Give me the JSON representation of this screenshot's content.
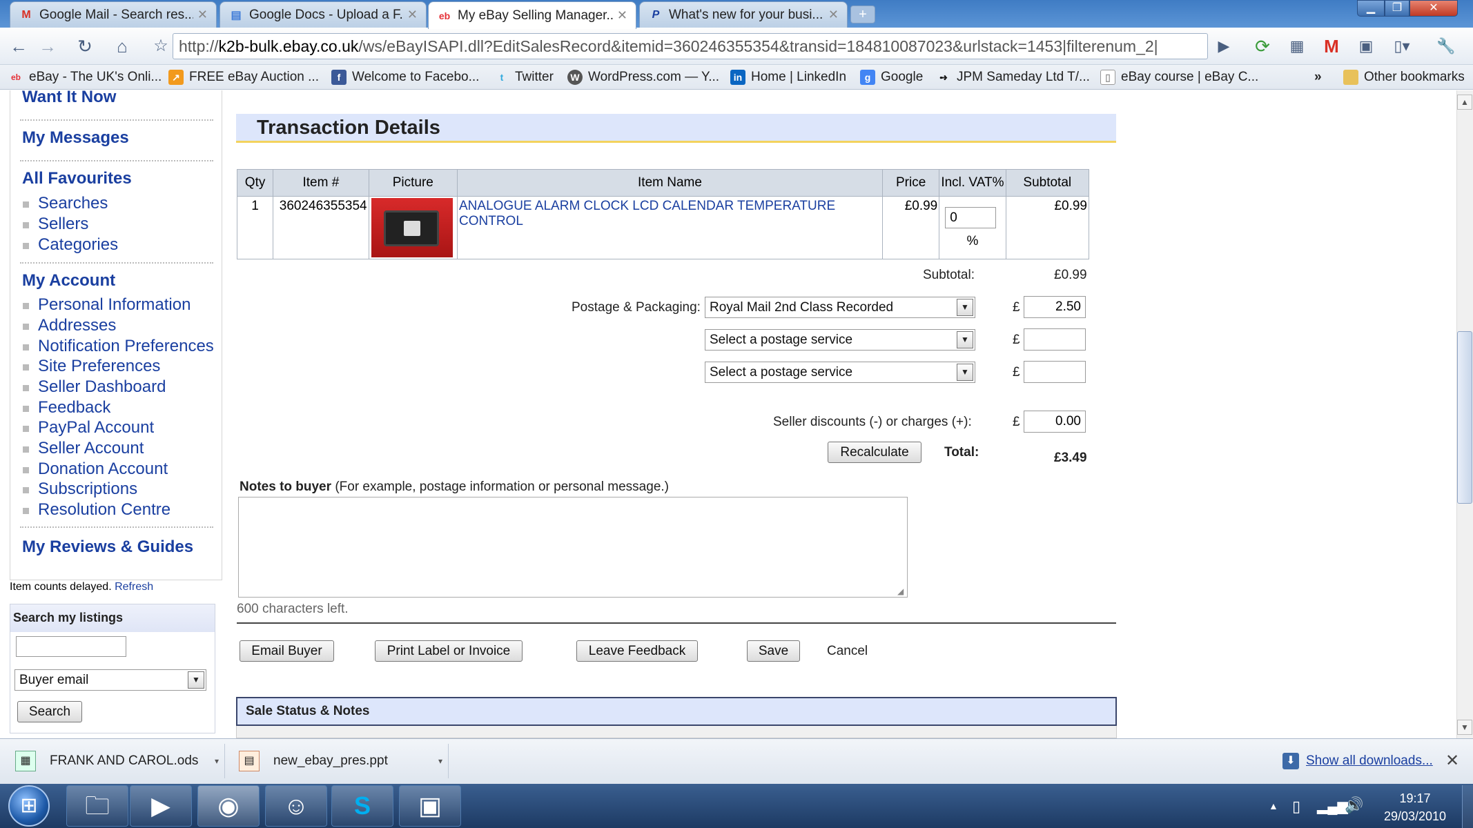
{
  "browser": {
    "tabs": [
      {
        "title": "Google Mail - Search res...",
        "icon": "gmail-icon"
      },
      {
        "title": "Google Docs - Upload a F...",
        "icon": "docs-icon"
      },
      {
        "title": "My eBay Selling Manager...",
        "icon": "ebay-icon"
      },
      {
        "title": "What's new for your busi...",
        "icon": "paypal-icon"
      }
    ],
    "url_prefix": "http://",
    "url_host": "k2b-bulk.ebay.co.uk",
    "url_path": "/ws/eBayISAPI.dll?EditSalesRecord&itemid=360246355354&transid=184810087023&urlstack=1453|filterenum_2|",
    "bookmarks": [
      "eBay - The UK's Onli...",
      "FREE eBay Auction ...",
      "Welcome to Facebo...",
      "Twitter",
      "WordPress.com — Y...",
      "Home | LinkedIn",
      "Google",
      "JPM Sameday Ltd T/...",
      "eBay course | eBay C..."
    ],
    "other_bookmarks": "Other bookmarks",
    "more": "»"
  },
  "sidebar": {
    "top_partial": "Want It Now",
    "messages": "My Messages",
    "favourites": "All Favourites",
    "fav_items": [
      "Searches",
      "Sellers",
      "Categories"
    ],
    "account": "My Account",
    "account_items": [
      "Personal Information",
      "Addresses",
      "Notification Preferences",
      "Site Preferences",
      "Seller Dashboard",
      "Feedback",
      "PayPal Account",
      "Seller Account",
      "Donation Account",
      "Subscriptions",
      "Resolution Centre"
    ],
    "reviews": "My Reviews & Guides",
    "delay_note": "Item counts delayed.",
    "refresh": "Refresh",
    "search_title": "Search my listings",
    "search_value": "",
    "search_by": "Buyer email",
    "search_button": "Search"
  },
  "main": {
    "title": "Transaction Details",
    "table": {
      "headers": [
        "Qty",
        "Item #",
        "Picture",
        "Item Name",
        "Price",
        "Incl. VAT%",
        "Subtotal"
      ],
      "row": {
        "qty": "1",
        "item_no": "360246355354",
        "name": "ANALOGUE ALARM CLOCK LCD CALENDAR TEMPERATURE CONTROL",
        "price": "£0.99",
        "vat": "0",
        "vat_unit": "%",
        "subtotal": "£0.99"
      }
    },
    "subtotal_label": "Subtotal:",
    "subtotal_value": "£0.99",
    "pp_label": "Postage & Packaging:",
    "pp_services": [
      "Royal Mail 2nd Class Recorded",
      "Select a postage service",
      "Select a postage service"
    ],
    "pp_costs": [
      "2.50",
      "",
      ""
    ],
    "currency": "£",
    "discount_label": "Seller discounts (-) or charges (+):",
    "discount_value": "0.00",
    "recalc": "Recalculate",
    "total_label": "Total:",
    "total_value": "£3.49",
    "notes_label": "Notes to buyer",
    "notes_hint": "(For example, postage information or personal message.)",
    "notes_value": "",
    "chars_left": "600 characters left.",
    "actions": [
      "Email Buyer",
      "Print Label or Invoice",
      "Leave Feedback",
      "Save"
    ],
    "cancel": "Cancel",
    "sale_status": "Sale Status & Notes"
  },
  "downloads": {
    "items": [
      "FRANK AND CAROL.ods",
      "new_ebay_pres.ppt"
    ],
    "show_all": "Show all downloads..."
  },
  "taskbar": {
    "time": "19:17",
    "date": "29/03/2010"
  }
}
